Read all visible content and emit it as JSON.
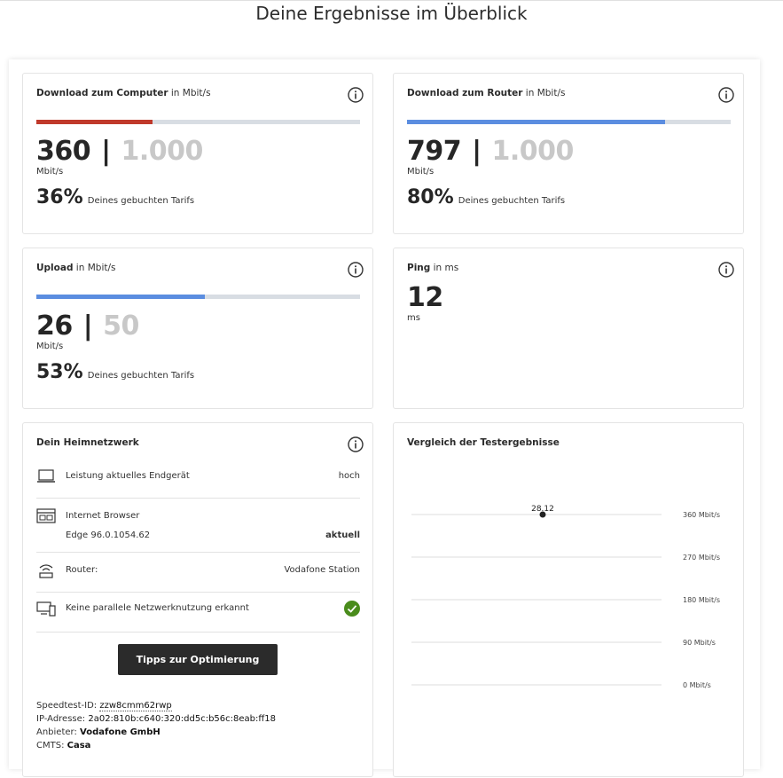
{
  "page": {
    "title": "Deine Ergebnisse im Überblick"
  },
  "download_computer": {
    "title_bold": "Download zum Computer",
    "title_suffix": " in Mbit/s",
    "value": "360",
    "separator": "|",
    "max": "1.000",
    "unit": "Mbit/s",
    "percent": "36%",
    "percent_text": "Deines gebuchten Tarifs",
    "bar_fraction": 0.36,
    "bar_color": "#c0392b"
  },
  "download_router": {
    "title_bold": "Download zum Router",
    "title_suffix": " in Mbit/s",
    "value": "797",
    "separator": "|",
    "max": "1.000",
    "unit": "Mbit/s",
    "percent": "80%",
    "percent_text": "Deines gebuchten Tarifs",
    "bar_fraction": 0.797,
    "bar_color": "#5b8de0"
  },
  "upload": {
    "title_bold": "Upload",
    "title_suffix": " in Mbit/s",
    "value": "26",
    "separator": "|",
    "max": "50",
    "unit": "Mbit/s",
    "percent": "53%",
    "percent_text": "Deines gebuchten Tarifs",
    "bar_fraction": 0.52,
    "bar_color": "#5b8de0"
  },
  "ping": {
    "title_bold": "Ping",
    "title_suffix": " in ms",
    "value": "12",
    "unit": "ms"
  },
  "home_network": {
    "title": "Dein Heimnetzwerk",
    "device": {
      "icon": "laptop-icon",
      "label": "Leistung aktuelles Endgerät",
      "value": "hoch"
    },
    "browser": {
      "icon": "browser-icon",
      "label": "Internet Browser",
      "sub_label": "Edge 96.0.1054.62",
      "value": "aktuell"
    },
    "router": {
      "icon": "wifi-router-icon",
      "label": "Router:",
      "value": "Vodafone Station"
    },
    "parallel": {
      "icon": "devices-icon",
      "label": "Keine parallele Netzwerknutzung erkannt",
      "status_icon": "check-circle-icon",
      "status_color": "#4a8c1c"
    },
    "button_label": "Tipps zur Optimierung",
    "speedtest_id_label": "Speedtest-ID:",
    "speedtest_id": "zzw8cmm62rwp",
    "ip_label": "IP-Adresse:",
    "ip": "2a02:810b:c640:320:dd5c:b56c:8eab:ff18",
    "provider_label": "Anbieter:",
    "provider": "Vodafone GmbH",
    "cmts_label": "CMTS:",
    "cmts": "Casa"
  },
  "comparison": {
    "title": "Vergleich der Testergebnisse"
  },
  "chart_data": {
    "type": "scatter",
    "title": "Vergleich der Testergebnisse",
    "y_ticks": [
      "360 Mbit/s",
      "270 Mbit/s",
      "180 Mbit/s",
      "90 Mbit/s",
      "0 Mbit/s"
    ],
    "ylim": [
      0,
      360
    ],
    "points": [
      {
        "label": "28.12",
        "y": 360
      }
    ],
    "grid": true
  }
}
